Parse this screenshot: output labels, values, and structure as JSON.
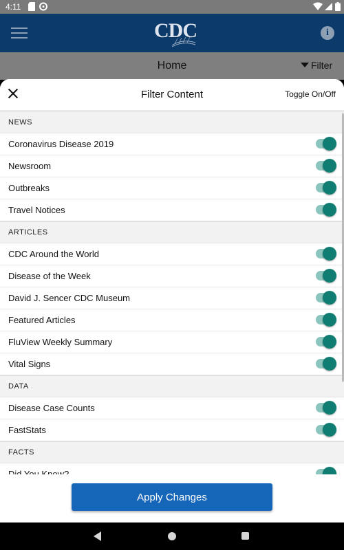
{
  "status_bar": {
    "time": "4:11"
  },
  "app_bar": {
    "logo_text": "CDC"
  },
  "sub_header": {
    "title": "Home",
    "filter_label": "Filter"
  },
  "sheet": {
    "title": "Filter Content",
    "toggle_all_label": "Toggle On/Off",
    "apply_label": "Apply Changes"
  },
  "sections": [
    {
      "title": "NEWS",
      "items": [
        {
          "label": "Coronavirus Disease 2019",
          "on": true
        },
        {
          "label": "Newsroom",
          "on": true
        },
        {
          "label": "Outbreaks",
          "on": true
        },
        {
          "label": "Travel Notices",
          "on": true
        }
      ]
    },
    {
      "title": "ARTICLES",
      "items": [
        {
          "label": "CDC Around the World",
          "on": true
        },
        {
          "label": "Disease of the Week",
          "on": true
        },
        {
          "label": "David J. Sencer CDC Museum",
          "on": true
        },
        {
          "label": "Featured Articles",
          "on": true
        },
        {
          "label": "FluView Weekly Summary",
          "on": true
        },
        {
          "label": "Vital Signs",
          "on": true
        }
      ]
    },
    {
      "title": "DATA",
      "items": [
        {
          "label": "Disease Case Counts",
          "on": true
        },
        {
          "label": "FastStats",
          "on": true
        }
      ]
    },
    {
      "title": "FACTS",
      "items": [
        {
          "label": "Did You Know?",
          "on": true
        }
      ]
    }
  ],
  "colors": {
    "switch_knob": "#0f7d72",
    "switch_track": "#8cc4be",
    "apply_button": "#1565b8",
    "app_bar": "#0b3a6b"
  }
}
